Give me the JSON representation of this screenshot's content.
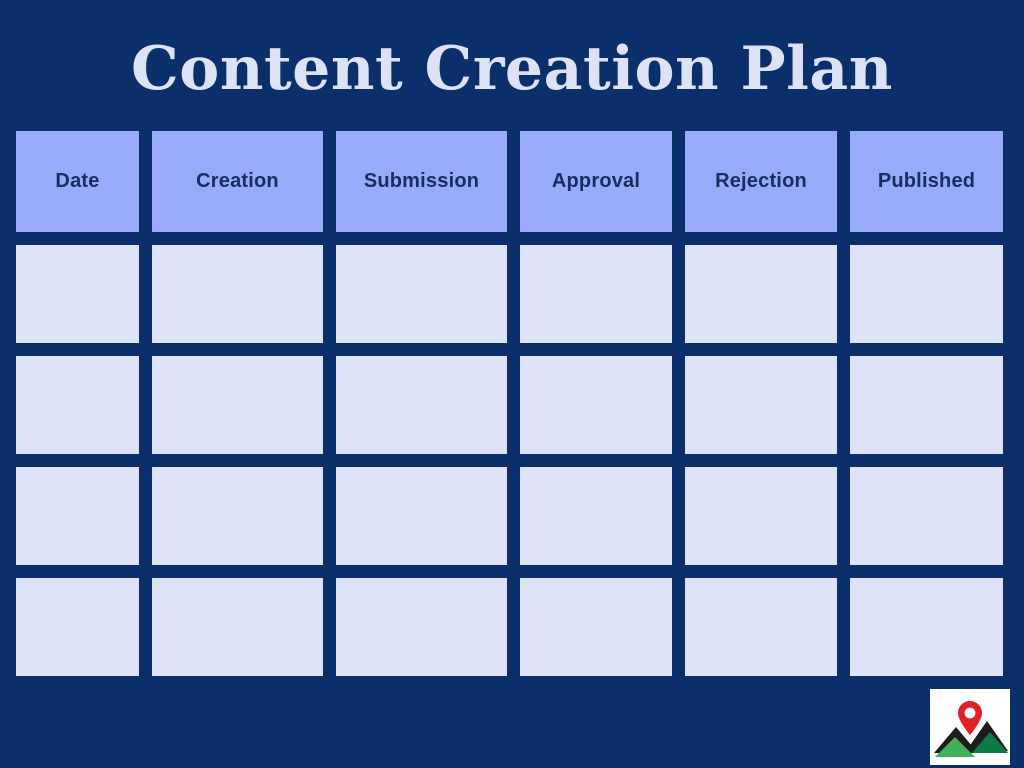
{
  "slide": {
    "title": "Content Creation Plan",
    "background_color": "#0a2f6b",
    "title_color": "#dde2f7"
  },
  "table": {
    "header_bg_color": "#99aafb",
    "header_text_color": "#13305f",
    "cell_bg_color": "#dfe3f9",
    "columns": [
      "Date",
      "Creation",
      "Submission",
      "Approval",
      "Rejection",
      "Published"
    ],
    "rows": [
      [
        "",
        "",
        "",
        "",
        "",
        ""
      ],
      [
        "",
        "",
        "",
        "",
        "",
        ""
      ],
      [
        "",
        "",
        "",
        "",
        "",
        ""
      ],
      [
        "",
        "",
        "",
        "",
        "",
        ""
      ]
    ]
  },
  "logo": {
    "name": "mountain-pin-logo",
    "box_color": "#ffffff",
    "peak_dark_color": "#1d1d1b",
    "peak_green_color": "#0e7a47",
    "peak_light_green_color": "#41b05a",
    "pin_color": "#e01f26"
  }
}
